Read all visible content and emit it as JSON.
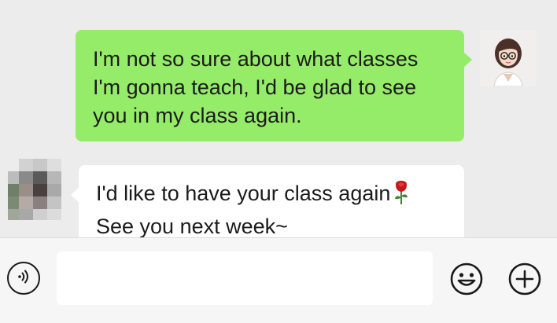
{
  "chat": {
    "messages": [
      {
        "direction": "outgoing",
        "lines": [
          "I'm not so sure about what classes",
          "I'm gonna teach, I'd be glad to see",
          "you in my class again."
        ],
        "bubble_color": "#95ec69"
      },
      {
        "direction": "incoming",
        "lines": [
          "I'd like to have your class again",
          "See you next week~"
        ],
        "emoji": "rose-icon",
        "bubble_color": "#ffffff"
      }
    ]
  },
  "input_bar": {
    "text_value": "",
    "placeholder": "",
    "voice_icon": "voice-icon",
    "emoji_icon": "smiley-icon",
    "plus_icon": "plus-icon"
  },
  "colors": {
    "background": "#ececec",
    "outgoing_bubble": "#95ec69",
    "incoming_bubble": "#ffffff",
    "input_bar": "#f6f6f6"
  }
}
